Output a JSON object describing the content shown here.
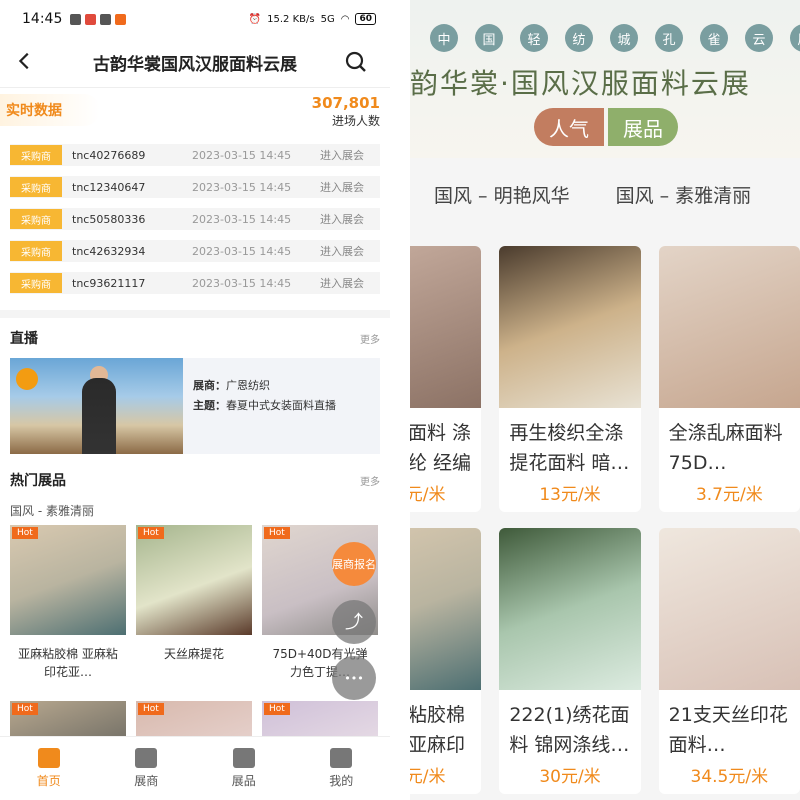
{
  "status": {
    "time": "14:45",
    "net": "15.2 KB/s",
    "signal": "5G",
    "battery": "60"
  },
  "header": {
    "title": "古韵华裳国风汉服面料云展"
  },
  "realtime": {
    "title": "实时数据",
    "count": "307,801",
    "count_label": "进场人数",
    "rows": [
      {
        "tag": "采购商",
        "id": "tnc40276689",
        "time": "2023-03-15 14:45",
        "action": "进入展会"
      },
      {
        "tag": "采购商",
        "id": "tnc12340647",
        "time": "2023-03-15 14:45",
        "action": "进入展会"
      },
      {
        "tag": "采购商",
        "id": "tnc50580336",
        "time": "2023-03-15 14:45",
        "action": "进入展会"
      },
      {
        "tag": "采购商",
        "id": "tnc42632934",
        "time": "2023-03-15 14:45",
        "action": "进入展会"
      },
      {
        "tag": "采购商",
        "id": "tnc93621117",
        "time": "2023-03-15 14:45",
        "action": "进入展会"
      }
    ]
  },
  "live": {
    "title": "直播",
    "more": "更多",
    "exhibitor_label": "展商：",
    "exhibitor": "广恩纺织",
    "topic_label": "主题：",
    "topic": "春夏中式女装面料直播"
  },
  "hot": {
    "title": "热门展品",
    "more": "更多",
    "subtitle": "国风 - 素雅清丽",
    "hot_tag": "Hot",
    "items": [
      {
        "name": "亚麻粘胶棉 亚麻粘印花亚…"
      },
      {
        "name": "天丝麻提花"
      },
      {
        "name": "75D+40D有光弹力色丁提…"
      }
    ]
  },
  "fabs": {
    "register": "展商报名",
    "more": "•••"
  },
  "tabbar": [
    {
      "label": "首页"
    },
    {
      "label": "展商"
    },
    {
      "label": "展品"
    },
    {
      "label": "我的"
    }
  ],
  "right": {
    "chips": [
      "中",
      "国",
      "轻",
      "纺",
      "城",
      "孔",
      "雀",
      "云",
      "展"
    ],
    "banner_title": "古韵华裳·国风汉服面料云展",
    "pill_left": "人气",
    "pill_right": "展品",
    "cats": [
      "国风 – 明艳风华",
      "国风 – 素雅清丽"
    ],
    "row1": [
      {
        "name": "面料 涤纶 经编织裙…",
        "price": "元/米"
      },
      {
        "name": "再生梭织全涤提花面料 暗…",
        "price": "13元/米"
      },
      {
        "name": "全涤乱麻面料 75D…",
        "price": "3.7元/米"
      }
    ],
    "row2": [
      {
        "name": "粘胶棉 亚麻印花亚…",
        "price": "元/米"
      },
      {
        "name": "222(1)绣花面料 锦网涤线…",
        "price": "30元/米"
      },
      {
        "name": "21支天丝印花面料…",
        "price": "34.5元/米"
      }
    ]
  }
}
